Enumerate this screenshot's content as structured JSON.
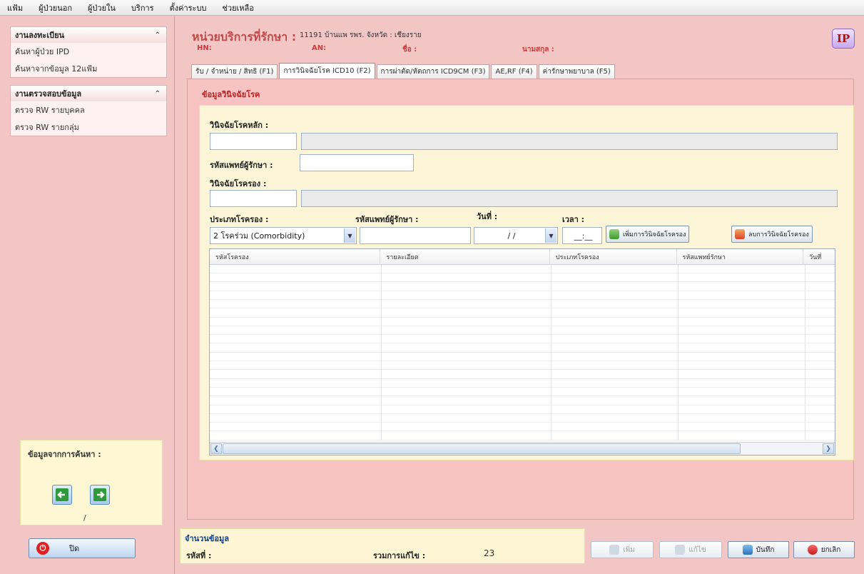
{
  "menu": [
    "แฟ้ม",
    "ผู้ป่วยนอก",
    "ผู้ป่วยใน",
    "บริการ",
    "ตั้งค่าระบบ",
    "ช่วยเหลือ"
  ],
  "sidebar": {
    "group1": {
      "title": "งานลงทะเบียน",
      "items": [
        "ค้นหาผู้ป่วย IPD",
        "ค้นหาจากข้อมูล 12แฟ้ม"
      ]
    },
    "group2": {
      "title": "งานตรวจสอบข้อมูล",
      "items": [
        "ตรวจ RW รายบุคคล",
        "ตรวจ RW รายกลุ่ม"
      ]
    },
    "search_title": "ข้อมูลจากการค้นหา :",
    "page_indicator": "/",
    "close_label": "ปิด"
  },
  "header": {
    "unit_label": "หน่วยบริการที่รักษา :",
    "unit_value": "11191 บ้านแพ รพร. จังหวัด : เชียงราย",
    "hn_label": "HN:",
    "an_label": "AN:",
    "name_label": "ชื่อ :",
    "surname_label": "นามสกุล :",
    "badge": "IP"
  },
  "tabs": [
    "รับ / จำหน่าย / สิทธิ (F1)",
    "การวินิจฉัยโรค ICD10 (F2)",
    "การผ่าตัด/หัตถการ ICD9CM (F3)",
    "AE,RF (F4)",
    "ค่ารักษาพยาบาล (F5)"
  ],
  "active_tab": 1,
  "form": {
    "section_title": "ข้อมูลวินิจฉัยโรค",
    "primary_dx_label": "วินิจฉัยโรคหลัก :",
    "doctor_code_label": "รหัสแพทย์ผู้รักษา :",
    "secondary_dx_label": "วินิจฉัยโรครอง :",
    "dx_type_label": "ประเภทโรครอง :",
    "doctor_code_label2": "รหัสแพทย์ผู้รักษา :",
    "date_label": "วันที่ :",
    "time_label": "เวลา :",
    "dx_type_value": "2 โรคร่วม (Comorbidity)",
    "date_value": "/ /",
    "time_value": "__:__",
    "add_button": "เพิ่มการวินิจฉัยโรครอง",
    "delete_button": "ลบการวินิจฉัยโรครอง"
  },
  "grid": {
    "columns": [
      "รหัสโรครอง",
      "รายละเอียด",
      "ประเภทโรครอง",
      "รหัสแพทย์รักษา",
      "วันที่"
    ]
  },
  "summary": {
    "title": "จำนวนข้อมูล",
    "current_label": "รหัสที่ :",
    "total_label": "รวมการแก้ไข :",
    "total_value": "23"
  },
  "buttons": {
    "add": "เพิ่ม",
    "edit": "แก้ไข",
    "save": "บันทึก",
    "cancel": "ยกเลิก"
  },
  "colors": {
    "accent": "#c04a4a",
    "panel": "#f3c6c6",
    "form_bg": "#fdf5d8"
  }
}
